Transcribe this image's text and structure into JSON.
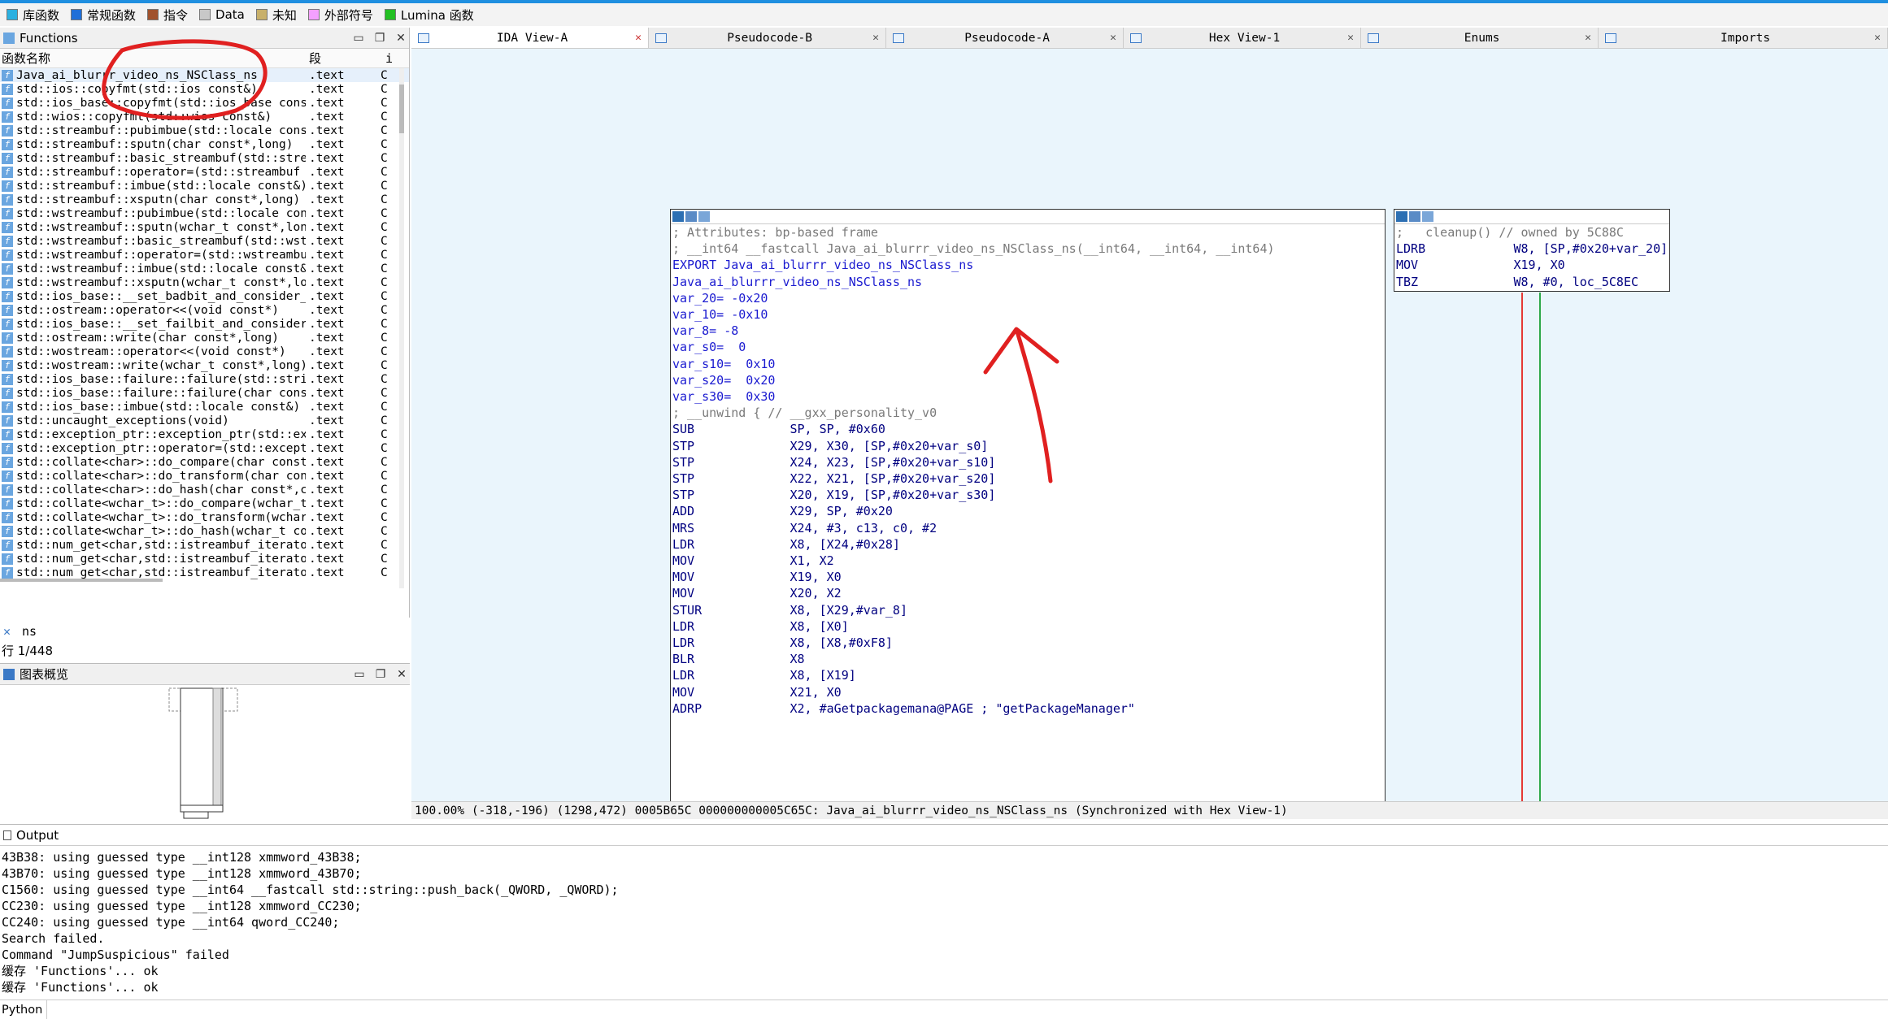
{
  "legend": {
    "items": [
      {
        "label": "库函数",
        "color": "#2bb0e0"
      },
      {
        "label": "常规函数",
        "color": "#1f6fd8"
      },
      {
        "label": "指令",
        "color": "#a0522d"
      },
      {
        "label": "Data",
        "color": "#c8c8c8"
      },
      {
        "label": "未知",
        "color": "#c8b06a"
      },
      {
        "label": "外部符号",
        "color": "#f4a0ff"
      },
      {
        "label": "Lumina 函数",
        "color": "#22c022"
      }
    ]
  },
  "functions_panel": {
    "title": "Functions",
    "col_name": "函数名称",
    "col_segment": "段",
    "col_extra": "i",
    "rows": [
      {
        "name": "Java_ai_blurrr_video_ns_NSClass_ns",
        "seg": ".text",
        "c": "C"
      },
      {
        "name": "std::ios::copyfmt(std::ios const&)",
        "seg": ".text",
        "c": "C"
      },
      {
        "name": "std::ios_base::copyfmt(std::ios_base cons⋯",
        "seg": ".text",
        "c": "C"
      },
      {
        "name": "std::wios::copyfmt(std::wios const&)",
        "seg": ".text",
        "c": "C"
      },
      {
        "name": "std::streambuf::pubimbue(std::locale cons⋯",
        "seg": ".text",
        "c": "C"
      },
      {
        "name": "std::streambuf::sputn(char const*,long)",
        "seg": ".text",
        "c": "C"
      },
      {
        "name": "std::streambuf::basic_streambuf(std::stre⋯",
        "seg": ".text",
        "c": "C"
      },
      {
        "name": "std::streambuf::operator=(std::streambuf ⋯",
        "seg": ".text",
        "c": "C"
      },
      {
        "name": "std::streambuf::imbue(std::locale const&)",
        "seg": ".text",
        "c": "C"
      },
      {
        "name": "std::streambuf::xsputn(char const*,long)",
        "seg": ".text",
        "c": "C"
      },
      {
        "name": "std::wstreambuf::pubimbue(std::locale con⋯",
        "seg": ".text",
        "c": "C"
      },
      {
        "name": "std::wstreambuf::sputn(wchar_t const*,long)",
        "seg": ".text",
        "c": "C"
      },
      {
        "name": "std::wstreambuf::basic_streambuf(std::wst⋯",
        "seg": ".text",
        "c": "C"
      },
      {
        "name": "std::wstreambuf::operator=(std::wstreambu⋯",
        "seg": ".text",
        "c": "C"
      },
      {
        "name": "std::wstreambuf::imbue(std::locale const&)",
        "seg": ".text",
        "c": "C"
      },
      {
        "name": "std::wstreambuf::xsputn(wchar_t const*,lo⋯",
        "seg": ".text",
        "c": "C"
      },
      {
        "name": "std::ios_base::__set_badbit_and_consider_⋯",
        "seg": ".text",
        "c": "C"
      },
      {
        "name": "std::ostream::operator<<(void const*)",
        "seg": ".text",
        "c": "C"
      },
      {
        "name": "std::ios_base::__set_failbit_and_consider⋯",
        "seg": ".text",
        "c": "C"
      },
      {
        "name": "std::ostream::write(char const*,long)",
        "seg": ".text",
        "c": "C"
      },
      {
        "name": "std::wostream::operator<<(void const*)",
        "seg": ".text",
        "c": "C"
      },
      {
        "name": "std::wostream::write(wchar_t const*,long)",
        "seg": ".text",
        "c": "C"
      },
      {
        "name": "std::ios_base::failure::failure(std::stri⋯",
        "seg": ".text",
        "c": "C"
      },
      {
        "name": "std::ios_base::failure::failure(char cons⋯",
        "seg": ".text",
        "c": "C"
      },
      {
        "name": "std::ios_base::imbue(std::locale const&)",
        "seg": ".text",
        "c": "C"
      },
      {
        "name": "std::uncaught_exceptions(void)",
        "seg": ".text",
        "c": "C"
      },
      {
        "name": "std::exception_ptr::exception_ptr(std::ex⋯",
        "seg": ".text",
        "c": "C"
      },
      {
        "name": "std::exception_ptr::operator=(std::except⋯",
        "seg": ".text",
        "c": "C"
      },
      {
        "name": "std::collate<char>::do_compare(char const⋯",
        "seg": ".text",
        "c": "C"
      },
      {
        "name": "std::collate<char>::do_transform(char con⋯",
        "seg": ".text",
        "c": "C"
      },
      {
        "name": "std::collate<char>::do_hash(char const*,c⋯",
        "seg": ".text",
        "c": "C"
      },
      {
        "name": "std::collate<wchar_t>::do_compare(wchar_t⋯",
        "seg": ".text",
        "c": "C"
      },
      {
        "name": "std::collate<wchar_t>::do_transform(wchar⋯",
        "seg": ".text",
        "c": "C"
      },
      {
        "name": "std::collate<wchar_t>::do_hash(wchar_t co⋯",
        "seg": ".text",
        "c": "C"
      },
      {
        "name": "std::num_get<char,std::istreambuf_iterato⋯",
        "seg": ".text",
        "c": "C"
      },
      {
        "name": "std::num_get<char,std::istreambuf_iterato⋯",
        "seg": ".text",
        "c": "C"
      },
      {
        "name": "std::num_get<char,std::istreambuf_iterato⋯",
        "seg": ".text",
        "c": "C"
      }
    ],
    "filter_text": "ns",
    "row_count": "行 1/448"
  },
  "overview_panel": {
    "title": "图表概览"
  },
  "tabs": [
    {
      "label": "IDA View-A",
      "active": true
    },
    {
      "label": "Pseudocode-B",
      "active": false
    },
    {
      "label": "Pseudocode-A",
      "active": false
    },
    {
      "label": "Hex View-1",
      "active": false
    },
    {
      "label": "Enums",
      "active": false
    },
    {
      "label": "Imports",
      "active": false
    }
  ],
  "main_node": {
    "lines": [
      "",
      "; Attributes: bp-based frame",
      "",
      "; __int64 __fastcall Java_ai_blurrr_video_ns_NSClass_ns(__int64, __int64, __int64)",
      "EXPORT Java_ai_blurrr_video_ns_NSClass_ns",
      "Java_ai_blurrr_video_ns_NSClass_ns",
      "",
      "var_20= -0x20",
      "var_10= -0x10",
      "var_8= -8",
      "var_s0=  0",
      "var_s10=  0x10",
      "var_s20=  0x20",
      "var_s30=  0x30",
      "",
      "; __unwind { // __gxx_personality_v0",
      "SUB             SP, SP, #0x60",
      "STP             X29, X30, [SP,#0x20+var_s0]",
      "STP             X24, X23, [SP,#0x20+var_s10]",
      "STP             X22, X21, [SP,#0x20+var_s20]",
      "STP             X20, X19, [SP,#0x20+var_s30]",
      "ADD             X29, SP, #0x20",
      "MRS             X24, #3, c13, c0, #2",
      "LDR             X8, [X24,#0x28]",
      "MOV             X1, X2",
      "MOV             X19, X0",
      "MOV             X20, X2",
      "STUR            X8, [X29,#var_8]",
      "LDR             X8, [X0]",
      "LDR             X8, [X8,#0xF8]",
      "BLR             X8",
      "LDR             X8, [X19]",
      "MOV             X21, X0",
      "ADRP            X2, #aGetpackagemana@PAGE ; \"getPackageManager\""
    ]
  },
  "cleanup_node": {
    "lines": [
      ";   cleanup() // owned by 5C88C",
      "LDRB            W8, [SP,#0x20+var_20]",
      "MOV             X19, X0",
      "TBZ             W8, #0, loc_5C8EC"
    ]
  },
  "status_line": "100.00% (-318,-196) (1298,472) 0005B65C 000000000005C65C: Java_ai_blurrr_video_ns_NSClass_ns (Synchronized with Hex View-1)",
  "output_panel": {
    "title": "Output",
    "lines": [
      "43B38: using guessed type __int128 xmmword_43B38;",
      "43B70: using guessed type __int128 xmmword_43B70;",
      "C1560: using guessed type __int64 __fastcall std::string::push_back(_QWORD, _QWORD);",
      "CC230: using guessed type __int128 xmmword_CC230;",
      "CC240: using guessed type __int64 qword_CC240;",
      "Search failed.",
      "Command \"JumpSuspicious\" failed",
      "缓存 'Functions'... ok",
      "缓存 'Functions'... ok"
    ],
    "python_label": "Python"
  },
  "annotations": {
    "circle_color": "#e02020",
    "arrow_color": "#e02020"
  }
}
